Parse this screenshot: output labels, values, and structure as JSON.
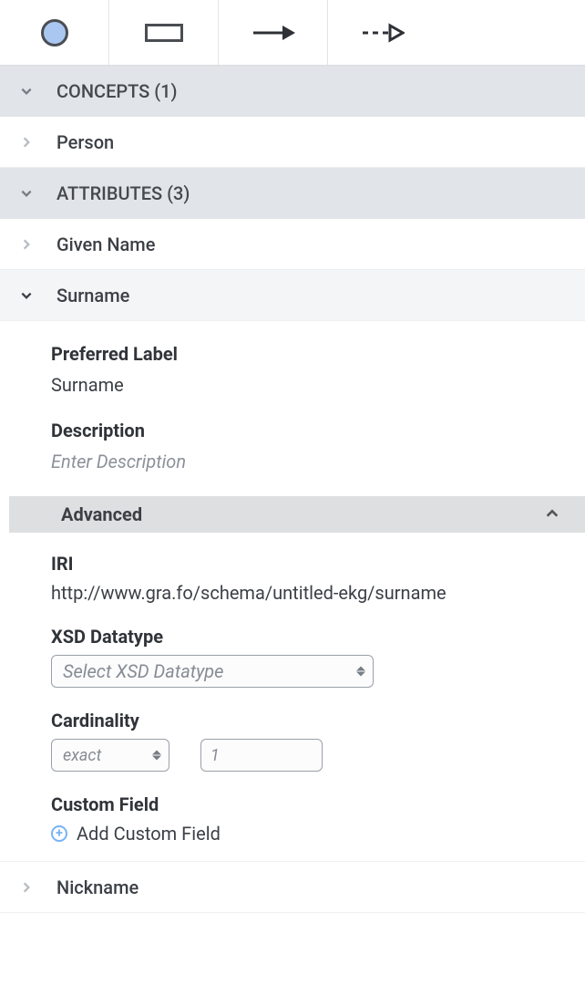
{
  "toolbar": {
    "tools": [
      "concept-circle",
      "concept-rect",
      "arrow-solid",
      "arrow-dashed"
    ]
  },
  "sections": {
    "concepts": {
      "label": "CONCEPTS (1)",
      "items": [
        {
          "label": "Person"
        }
      ]
    },
    "attributes": {
      "label": "ATTRIBUTES (3)",
      "items": [
        {
          "label": "Given Name"
        },
        {
          "label": "Surname",
          "expanded": true,
          "detail": {
            "preferred_label_label": "Preferred Label",
            "preferred_label_value": "Surname",
            "description_label": "Description",
            "description_placeholder": "Enter Description",
            "advanced_label": "Advanced",
            "iri_label": "IRI",
            "iri_value": "http://www.gra.fo/schema/untitled-ekg/surname",
            "xsd_label": "XSD Datatype",
            "xsd_placeholder": "Select XSD Datatype",
            "cardinality_label": "Cardinality",
            "cardinality_mode": "exact",
            "cardinality_value_placeholder": "1",
            "custom_field_label": "Custom Field",
            "add_custom_label": "Add Custom Field"
          }
        },
        {
          "label": "Nickname"
        }
      ]
    }
  }
}
